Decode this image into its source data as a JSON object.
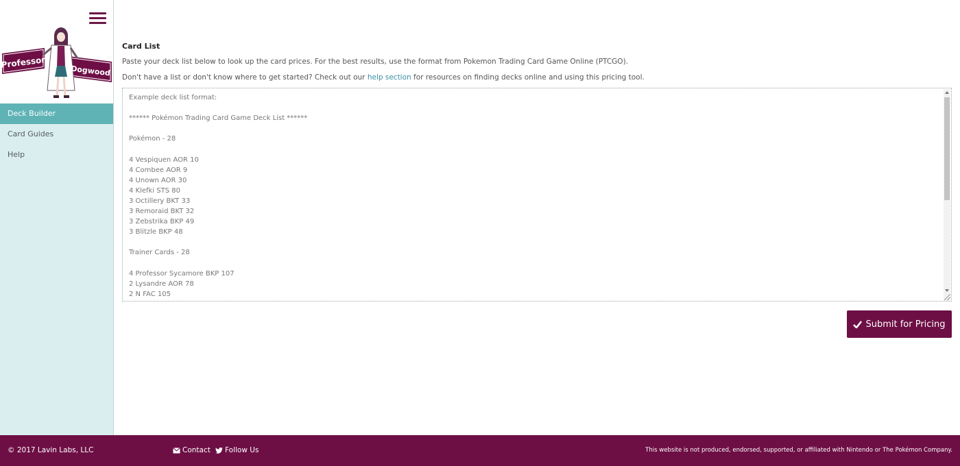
{
  "colors": {
    "brand": "#6d0f45",
    "nav_active": "#5fb3b5",
    "sidebar_bg": "#daeef0",
    "link": "#3a8fa6"
  },
  "logo": {
    "word_left": "Professor",
    "word_right": "Dogwood"
  },
  "sidebar": {
    "items": [
      {
        "label": "Deck Builder",
        "active": true
      },
      {
        "label": "Card Guides",
        "active": false
      },
      {
        "label": "Help",
        "active": false
      }
    ]
  },
  "main": {
    "title": "Card List",
    "intro": "Paste your deck list below to look up the card prices. For the best results, use the format from Pokemon Trading Card Game Online (PTCGO).",
    "help_prefix": "Don't have a list or don't know where to get started? Check out our ",
    "help_link": "help section",
    "help_suffix": " for resources on finding decks online and using this pricing tool.",
    "placeholder": "Example deck list format:\n\n****** Pokémon Trading Card Game Deck List ******\n\nPokémon - 28\n\n4 Vespiquen AOR 10\n4 Combee AOR 9\n4 Unown AOR 30\n4 Klefki STS 80\n3 Octillery BKT 33\n3 Remoraid BKT 32\n3 Zebstrika BKP 49\n3 Blitzle BKP 48\n\nTrainer Cards - 28\n\n4 Professor Sycamore BKP 107\n2 Lysandre AOR 78\n2 N FAC 105",
    "submit_label": "Submit for Pricing"
  },
  "footer": {
    "copyright": "© 2017 Lavin Labs, LLC",
    "contact": "Contact",
    "follow": "Follow Us",
    "disclaimer": "This website is not produced, endorsed, supported, or affiliated with Nintendo or The Pokémon Company."
  }
}
